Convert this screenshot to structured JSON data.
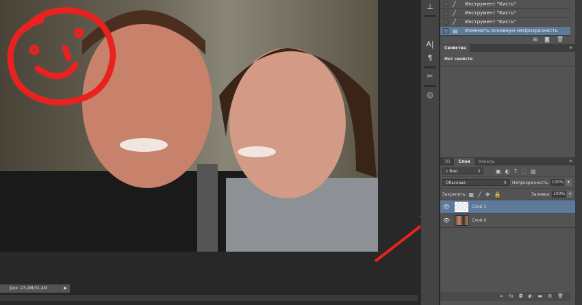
{
  "history": {
    "items": [
      {
        "label": "Инструмент \"Кисть\""
      },
      {
        "label": "Инструмент \"Кисть\""
      },
      {
        "label": "Инструмент \"Кисть\""
      },
      {
        "label": "Изменить основную непрозрачность",
        "selected": true
      }
    ]
  },
  "properties": {
    "tab": "Свойства",
    "empty_text": "Нет свойств"
  },
  "layers": {
    "tabs": [
      "3D",
      "Слои",
      "Каналы"
    ],
    "active_tab": "Слои",
    "filter": "Вид",
    "blend_mode": "Обычные",
    "opacity_label": "Непрозрачность:",
    "opacity": "100%",
    "lock_label": "Закрепить:",
    "fill_label": "Заливка:",
    "fill": "100%",
    "items": [
      {
        "name": "Слой 1",
        "selected": true
      },
      {
        "name": "Слой 0",
        "selected": false
      }
    ]
  },
  "status": {
    "doc": "Док: 23,4M/31,4M"
  },
  "colors": {
    "selection": "#5d7a9a",
    "annotation": "#e8231f"
  }
}
